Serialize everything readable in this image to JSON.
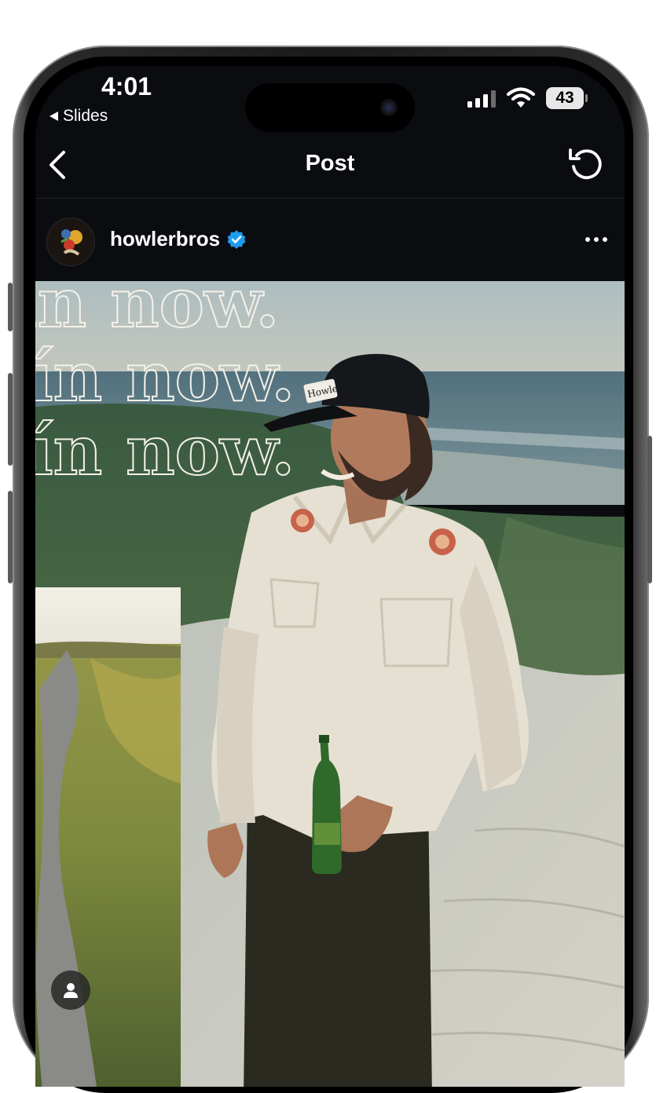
{
  "status_bar": {
    "time": "4:01",
    "back_app_label": "Slides",
    "battery_level": "43",
    "signal_bars": 4,
    "signal_bars_active": 3
  },
  "nav": {
    "title": "Post",
    "back_icon": "chevron-left-icon",
    "refresh_icon": "refresh-icon"
  },
  "post": {
    "username": "howlerbros",
    "verified": true,
    "more_icon": "more-horizontal-icon",
    "overlay_text": [
      "in now.",
      "ín now.",
      "ín now."
    ],
    "cap_logo_text": "Howler",
    "user_tag_icon": "person-icon"
  },
  "colors": {
    "screen_bg": "#0a0c10",
    "verified_blue": "#1d9bf0",
    "text": "#ffffff"
  }
}
